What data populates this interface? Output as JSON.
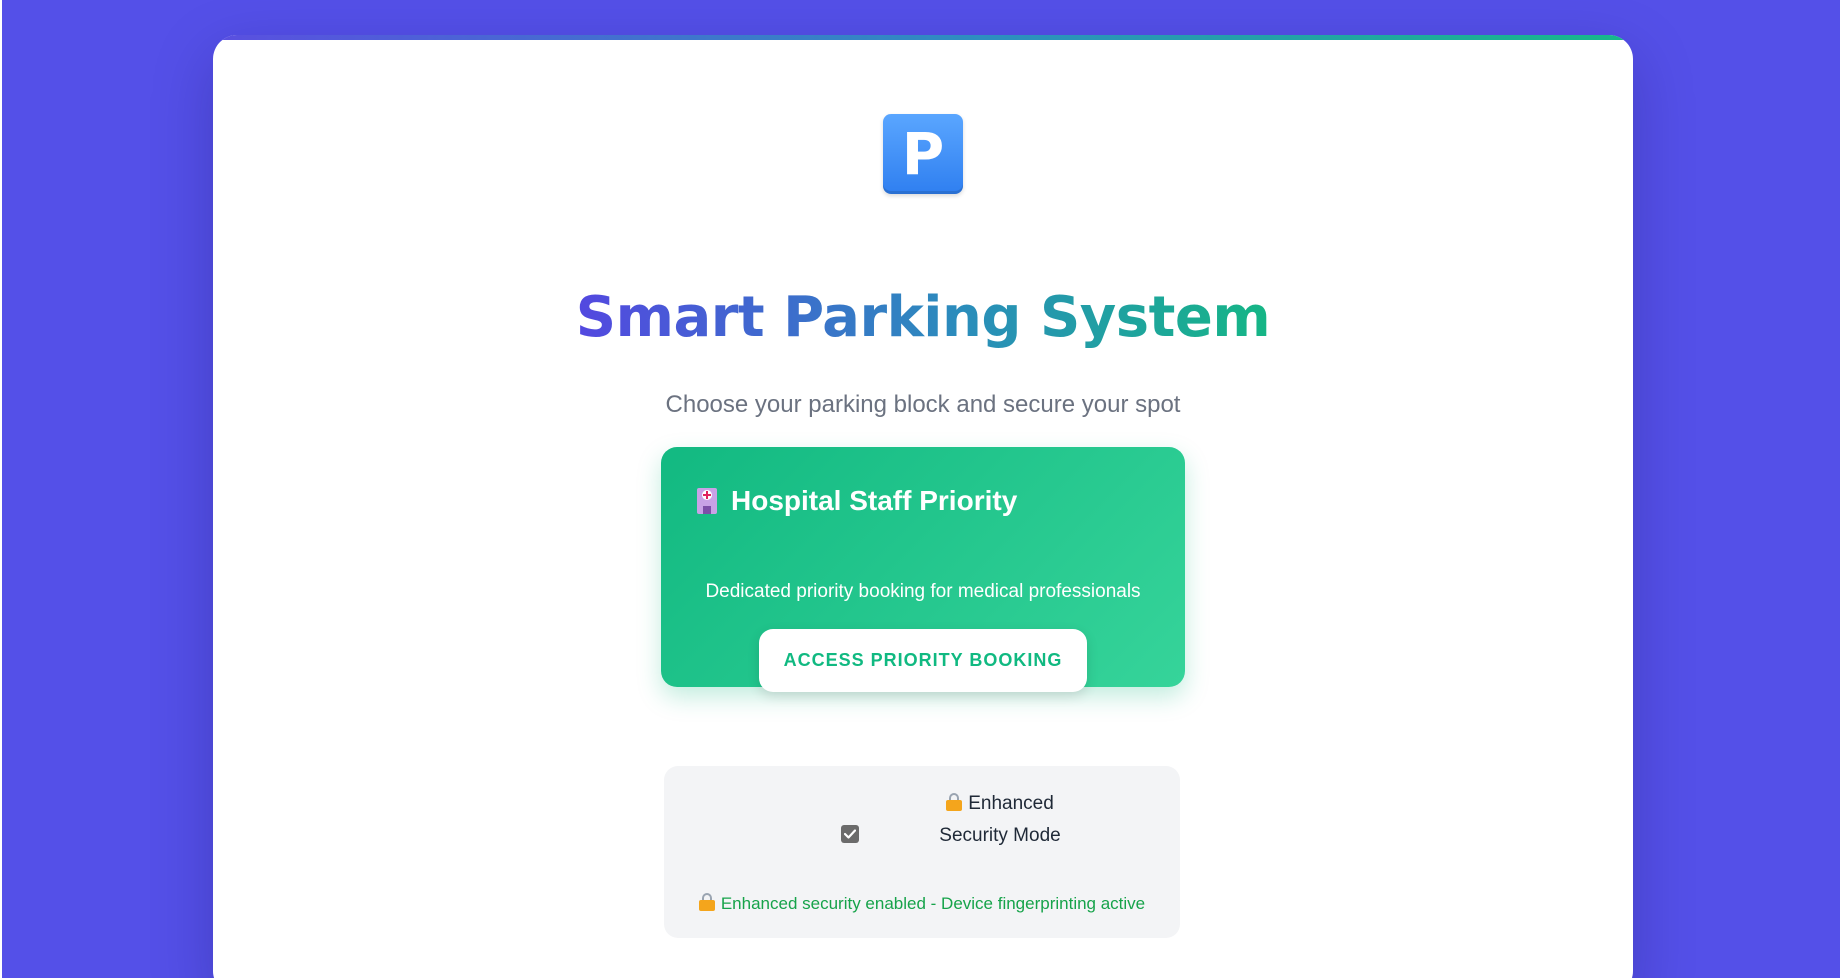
{
  "app": {
    "logo_letter": "P",
    "title": "Smart Parking System",
    "subtitle": "Choose your parking block and secure your spot"
  },
  "priority_card": {
    "icon": "hospital-icon",
    "heading": "Hospital Staff Priority",
    "description": "Dedicated priority booking for medical professionals",
    "button_label": "ACCESS PRIORITY BOOKING"
  },
  "security": {
    "checkbox_checked": true,
    "label": "Enhanced Security Mode",
    "lock_icon": "lock-icon",
    "status_text": "Enhanced security enabled - Device fingerprinting active"
  },
  "colors": {
    "background": "#5450e8",
    "accent_green": "#10b981",
    "status_green": "#16a34a",
    "title_gradient_start": "#5348e0",
    "title_gradient_end": "#15b685"
  }
}
